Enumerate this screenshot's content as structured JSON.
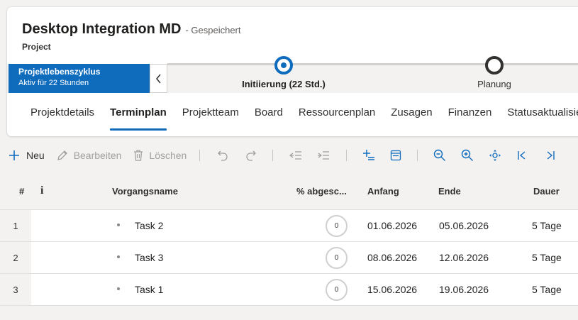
{
  "header": {
    "title": "Desktop Integration MD",
    "save_status": "- Gespeichert",
    "entity": "Project"
  },
  "bpf": {
    "flyout_title": "Projektlebenszyklus",
    "flyout_subtitle": "Aktiv für 22 Stunden",
    "stages": [
      {
        "label": "Initiierung  (22 Std.)",
        "state": "active"
      },
      {
        "label": "Planung",
        "state": "inactive"
      }
    ]
  },
  "tabs": [
    {
      "label": "Projektdetails",
      "selected": false
    },
    {
      "label": "Terminplan",
      "selected": true
    },
    {
      "label": "Projektteam",
      "selected": false
    },
    {
      "label": "Board",
      "selected": false
    },
    {
      "label": "Ressourcenplan",
      "selected": false
    },
    {
      "label": "Zusagen",
      "selected": false
    },
    {
      "label": "Finanzen",
      "selected": false
    },
    {
      "label": "Statusaktualisierungen",
      "selected": false
    }
  ],
  "commands": {
    "new_label": "Neu",
    "edit_label": "Bearbeiten",
    "delete_label": "Löschen",
    "icons": [
      "add-icon",
      "edit-icon",
      "delete-icon",
      "undo-icon",
      "redo-icon",
      "outdent-icon",
      "indent-icon",
      "add-subtask-icon",
      "timeline-icon",
      "zoom-out-icon",
      "zoom-in-icon",
      "fit-to-screen-icon",
      "go-to-start-icon",
      "go-to-end-icon"
    ]
  },
  "grid": {
    "columns": {
      "row_number": "#",
      "info": "i",
      "task_name": "Vorgangsname",
      "percent_complete": "% abgesc...",
      "start": "Anfang",
      "finish": "Ende",
      "duration": "Dauer"
    },
    "rows": [
      {
        "num": "1",
        "name": "Task 2",
        "pct": "0",
        "start": "01.06.2026",
        "finish": "05.06.2026",
        "duration": "5 Tage"
      },
      {
        "num": "2",
        "name": "Task 3",
        "pct": "0",
        "start": "08.06.2026",
        "finish": "12.06.2026",
        "duration": "5 Tage"
      },
      {
        "num": "3",
        "name": "Task 1",
        "pct": "0",
        "start": "15.06.2026",
        "finish": "19.06.2026",
        "duration": "5 Tage"
      }
    ]
  },
  "colors": {
    "accent": "#0f6cbd",
    "text": "#323130",
    "disabled": "#a19f9d",
    "background": "#f3f2f1"
  }
}
